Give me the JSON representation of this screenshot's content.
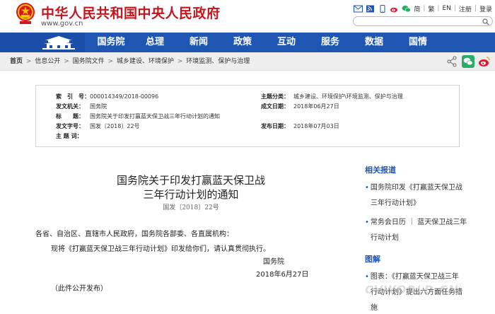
{
  "header": {
    "site_title": "中华人民共和国中央人民政府",
    "site_url": "www.gov.cn",
    "top_links": {
      "simplified": "简",
      "traditional": "繁",
      "english": "EN",
      "register": "注册",
      "login": "登录"
    },
    "search": {
      "placeholder": ""
    }
  },
  "nav": {
    "items": [
      {
        "label": "国务院"
      },
      {
        "label": "总理"
      },
      {
        "label": "新闻"
      },
      {
        "label": "政策"
      },
      {
        "label": "互动"
      },
      {
        "label": "服务"
      },
      {
        "label": "数据"
      },
      {
        "label": "国情"
      }
    ]
  },
  "breadcrumb": {
    "items": [
      {
        "label": "首页"
      },
      {
        "label": "信息公开"
      },
      {
        "label": "国务院文件"
      },
      {
        "label": "城乡建设、环境保护"
      },
      {
        "label": "环境监测、保护与治理"
      }
    ],
    "separator": ">"
  },
  "info": {
    "index_no": {
      "label": "索　引　号：",
      "value": "000014349/2018-00096"
    },
    "topic": {
      "label": "主题分类：",
      "value": "城乡建设、环境保护\\环境监测、保护与治理"
    },
    "issuer": {
      "label": "发文机关：",
      "value": "国务院"
    },
    "written_date": {
      "label": "成文日期：",
      "value": "2018年06月27日"
    },
    "title": {
      "label": "标　　题：",
      "value": "国务院关于印发打赢蓝天保卫战三年行动计划的通知"
    },
    "doc_no": {
      "label": "发文字号：",
      "value": "国发〔2018〕22号"
    },
    "publish_date": {
      "label": "发布日期：",
      "value": "2018年07月03日"
    },
    "keywords": {
      "label": "主  题  词：",
      "value": ""
    }
  },
  "article": {
    "title_line1": "国务院关于印发打赢蓝天保卫战",
    "title_line2": "三年行动计划的通知",
    "doc_no": "国发〔2018〕22号",
    "addressees": "各省、自治区、直辖市人民政府，国务院各部委、各直属机构：",
    "body": "现将《打赢蓝天保卫战三年行动计划》印发给你们，请认真贯彻执行。",
    "signer": "国务院",
    "date": "2018年6月27日",
    "note": "（此件公开发布）"
  },
  "sidebar": {
    "related_title": "相关报道",
    "related": [
      {
        "line1": "国务院印发《打赢蓝天保卫战",
        "line2": "三年行动计划》"
      },
      {
        "line1": "常务会日历 ｜ 蓝天保卫战三年",
        "line2": "行动计划"
      }
    ],
    "graphic_title": "图解",
    "graphic": [
      {
        "line1": "图表：《打赢蓝天保卫战三年",
        "line2": "行动计划》提出六方面任务措",
        "line3": "施"
      }
    ]
  },
  "watermark": "CVWORLD.CN",
  "colors": {
    "brand_red": "#c4161c",
    "nav_blue": "#1f56b3",
    "link_blue": "#1f56b3"
  }
}
